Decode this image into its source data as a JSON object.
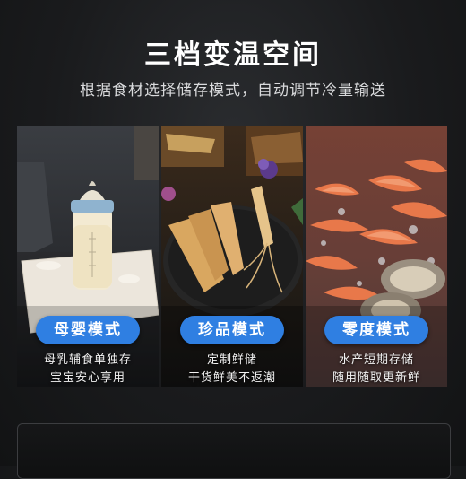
{
  "header": {
    "title": "三档变温空间",
    "subtitle": "根据食材选择储存模式，自动调节冷量输送"
  },
  "modes": [
    {
      "label": "母婴模式",
      "lines": [
        "母乳辅食单独存",
        "宝宝安心享用"
      ]
    },
    {
      "label": "珍品模式",
      "lines": [
        "定制鲜储",
        "干货鲜美不返潮"
      ]
    },
    {
      "label": "零度模式",
      "lines": [
        "水产短期存储",
        "随用随取更新鲜"
      ]
    }
  ],
  "colors": {
    "badge": "#2f7fe2",
    "background": "#1a1b1d"
  }
}
